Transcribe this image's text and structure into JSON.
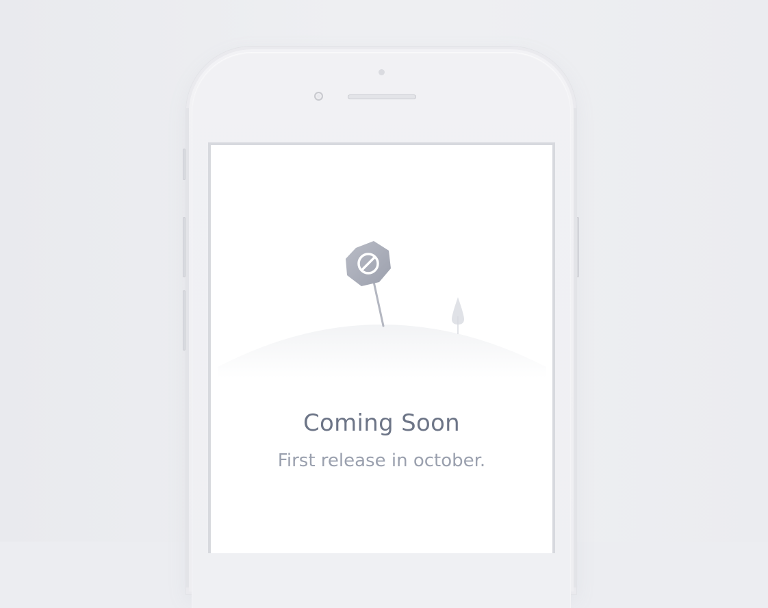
{
  "screen": {
    "title": "Coming Soon",
    "subtitle": "First release in october."
  },
  "illustration": {
    "sign_icon": "no-entry-sign-icon",
    "tree_icon": "tree-icon",
    "colors": {
      "sign": "#a8acb8",
      "sign_face": "#8f94a2",
      "pole": "#b7bac4",
      "hill": "#f4f5f7",
      "tree": "#dfe1e6"
    }
  },
  "colors": {
    "background": "#ecedf1",
    "title": "#6d7587",
    "subtitle": "#9aa0ae"
  }
}
